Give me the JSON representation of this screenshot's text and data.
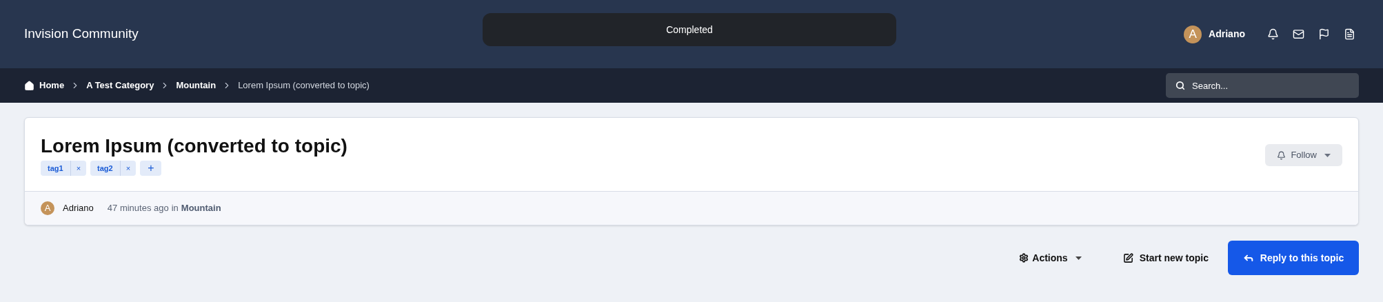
{
  "header": {
    "site_title": "Invision Community",
    "toast": "Completed",
    "user": {
      "avatar_letter": "A",
      "name": "Adriano"
    }
  },
  "breadcrumbs": [
    {
      "label": "Home",
      "kind": "home"
    },
    {
      "label": "A Test Category",
      "kind": "link"
    },
    {
      "label": "Mountain",
      "kind": "link"
    },
    {
      "label": "Lorem Ipsum (converted to topic)",
      "kind": "current"
    }
  ],
  "search": {
    "placeholder": "Search..."
  },
  "topic": {
    "title": "Lorem Ipsum (converted to topic)",
    "tags": [
      {
        "label": "tag1",
        "remove": "×"
      },
      {
        "label": "tag2",
        "remove": "×"
      }
    ],
    "add_tag": "+",
    "follow": "Follow",
    "author": {
      "avatar_letter": "A",
      "name": "Adriano"
    },
    "time": "47 minutes ago",
    "in": "in",
    "forum": "Mountain"
  },
  "actions": {
    "actions": "Actions",
    "start": "Start new topic",
    "reply": "Reply to this topic"
  }
}
